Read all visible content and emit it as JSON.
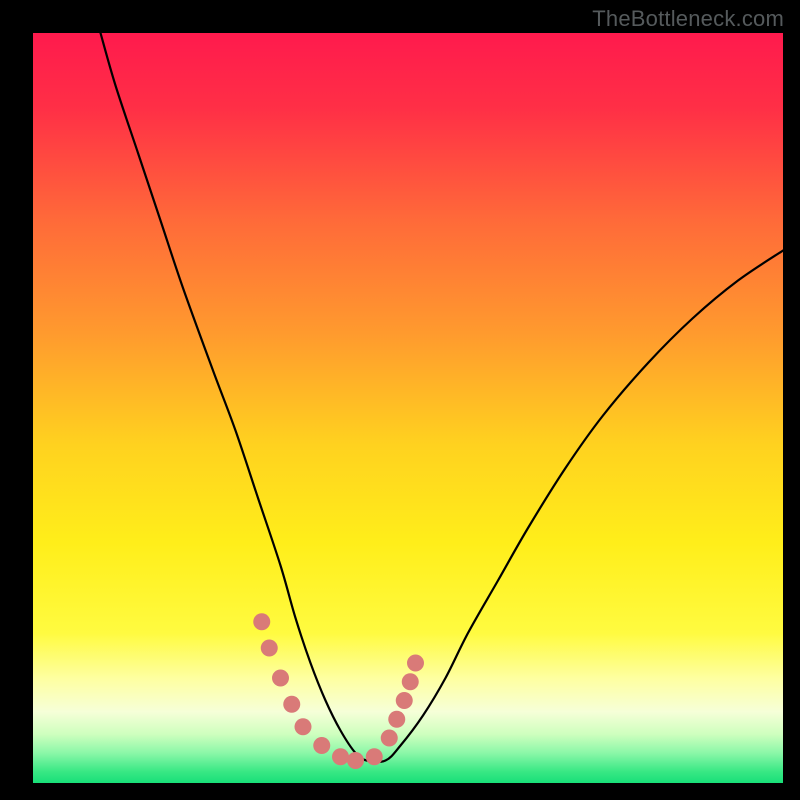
{
  "watermark": {
    "text": "TheBottleneck.com"
  },
  "gradient": {
    "stops": [
      {
        "offset": 0.0,
        "color": "#ff1a4d"
      },
      {
        "offset": 0.1,
        "color": "#ff2f46"
      },
      {
        "offset": 0.25,
        "color": "#ff6a39"
      },
      {
        "offset": 0.4,
        "color": "#ff9a2e"
      },
      {
        "offset": 0.55,
        "color": "#ffd21f"
      },
      {
        "offset": 0.68,
        "color": "#ffee1a"
      },
      {
        "offset": 0.8,
        "color": "#fffb40"
      },
      {
        "offset": 0.86,
        "color": "#feffa0"
      },
      {
        "offset": 0.905,
        "color": "#f6ffd8"
      },
      {
        "offset": 0.935,
        "color": "#ceffbe"
      },
      {
        "offset": 0.96,
        "color": "#8bf7a8"
      },
      {
        "offset": 0.985,
        "color": "#38e884"
      },
      {
        "offset": 1.0,
        "color": "#18df78"
      }
    ]
  },
  "chart_data": {
    "type": "line",
    "title": "",
    "xlabel": "",
    "ylabel": "",
    "xlim": [
      0,
      100
    ],
    "ylim": [
      0,
      100
    ],
    "grid": false,
    "series": [
      {
        "name": "bottleneck-curve",
        "note": "V-shaped curve (black). Higher y = worse match (red zone). Values estimated from pixel positions; x is relative horizontal position 0–100, y is relative vertical position 0–100 where 0 is bottom.",
        "x": [
          9,
          11,
          14,
          17,
          20,
          24,
          27,
          30,
          33,
          35,
          37,
          39,
          41,
          43,
          44.5,
          47,
          49,
          52,
          55,
          58,
          62,
          66,
          71,
          76,
          82,
          88,
          94,
          100
        ],
        "values": [
          100,
          93,
          84,
          75,
          66,
          55,
          47,
          38,
          29,
          22,
          16,
          11,
          7,
          4,
          3,
          3,
          5,
          9,
          14,
          20,
          27,
          34,
          42,
          49,
          56,
          62,
          67,
          71
        ]
      },
      {
        "name": "highlight-dots",
        "note": "Salmon/pink marker dots near the valley (dashed/dotted segment). Estimated positions.",
        "x": [
          30.5,
          31.5,
          33.0,
          34.5,
          36.0,
          38.5,
          41.0,
          43.0,
          45.5,
          47.5,
          48.5,
          49.5,
          50.3,
          51.0
        ],
        "values": [
          21.5,
          18.0,
          14.0,
          10.5,
          7.5,
          5.0,
          3.5,
          3.0,
          3.5,
          6.0,
          8.5,
          11.0,
          13.5,
          16.0
        ]
      }
    ],
    "zones_vertical": [
      {
        "label": "red",
        "y_range": [
          60,
          100
        ]
      },
      {
        "label": "orange",
        "y_range": [
          35,
          60
        ]
      },
      {
        "label": "yellow",
        "y_range": [
          8,
          35
        ]
      },
      {
        "label": "green",
        "y_range": [
          0,
          8
        ]
      }
    ]
  }
}
